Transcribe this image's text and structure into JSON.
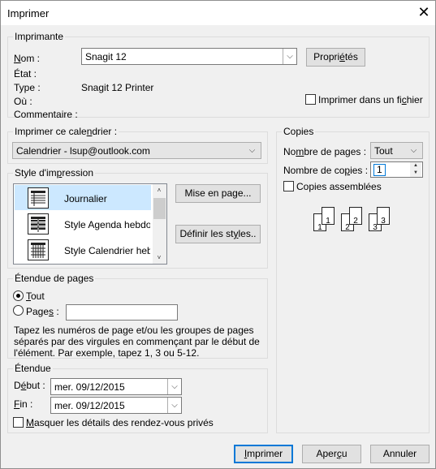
{
  "dialog": {
    "title": "Imprimer",
    "close_glyph": "✕"
  },
  "printer": {
    "group": "Imprimante",
    "name_label": "Nom :",
    "name_value": "Snagit 12",
    "properties_button": "Propriétés",
    "state_label": "État :",
    "type_label": "Type :",
    "type_value": "Snagit 12 Printer",
    "where_label": "Où :",
    "comment_label": "Commentaire :",
    "print_to_file": "Imprimer dans un fichier"
  },
  "calendar": {
    "group": "Imprimer ce calendrier :",
    "value": "Calendrier - lsup@outlook.com"
  },
  "style": {
    "group": "Style d'impression",
    "items": [
      "Journalier",
      "Style Agenda hebdomadaire",
      "Style Calendrier hebdomadaire"
    ],
    "page_setup_button": "Mise en page...",
    "define_styles_button": "Définir les styles..."
  },
  "pages": {
    "group": "Étendue de pages",
    "all_label": "Tout",
    "pages_label": "Pages :",
    "pages_value": "",
    "help": "Tapez les numéros de page et/ou les groupes de pages séparés par des virgules en commençant par le début de l'élément. Par exemple, tapez 1, 3 ou 5-12."
  },
  "range": {
    "group": "Étendue",
    "start_label": "Début :",
    "start_value": "mer. 09/12/2015",
    "end_label": "Fin :",
    "end_value": "mer. 09/12/2015",
    "hide_private": "Masquer les détails des rendez-vous privés"
  },
  "copies": {
    "group": "Copies",
    "num_pages_label": "Nombre de pages :",
    "num_pages_value": "Tout",
    "num_copies_label": "Nombre de copies :",
    "num_copies_value": "1",
    "collate_label": "Copies assemblées",
    "page_numbers": [
      "1",
      "1",
      "2",
      "2",
      "3",
      "3"
    ]
  },
  "footer": {
    "print_button": "Imprimer",
    "preview_button": "Aperçu",
    "cancel_button": "Annuler"
  }
}
